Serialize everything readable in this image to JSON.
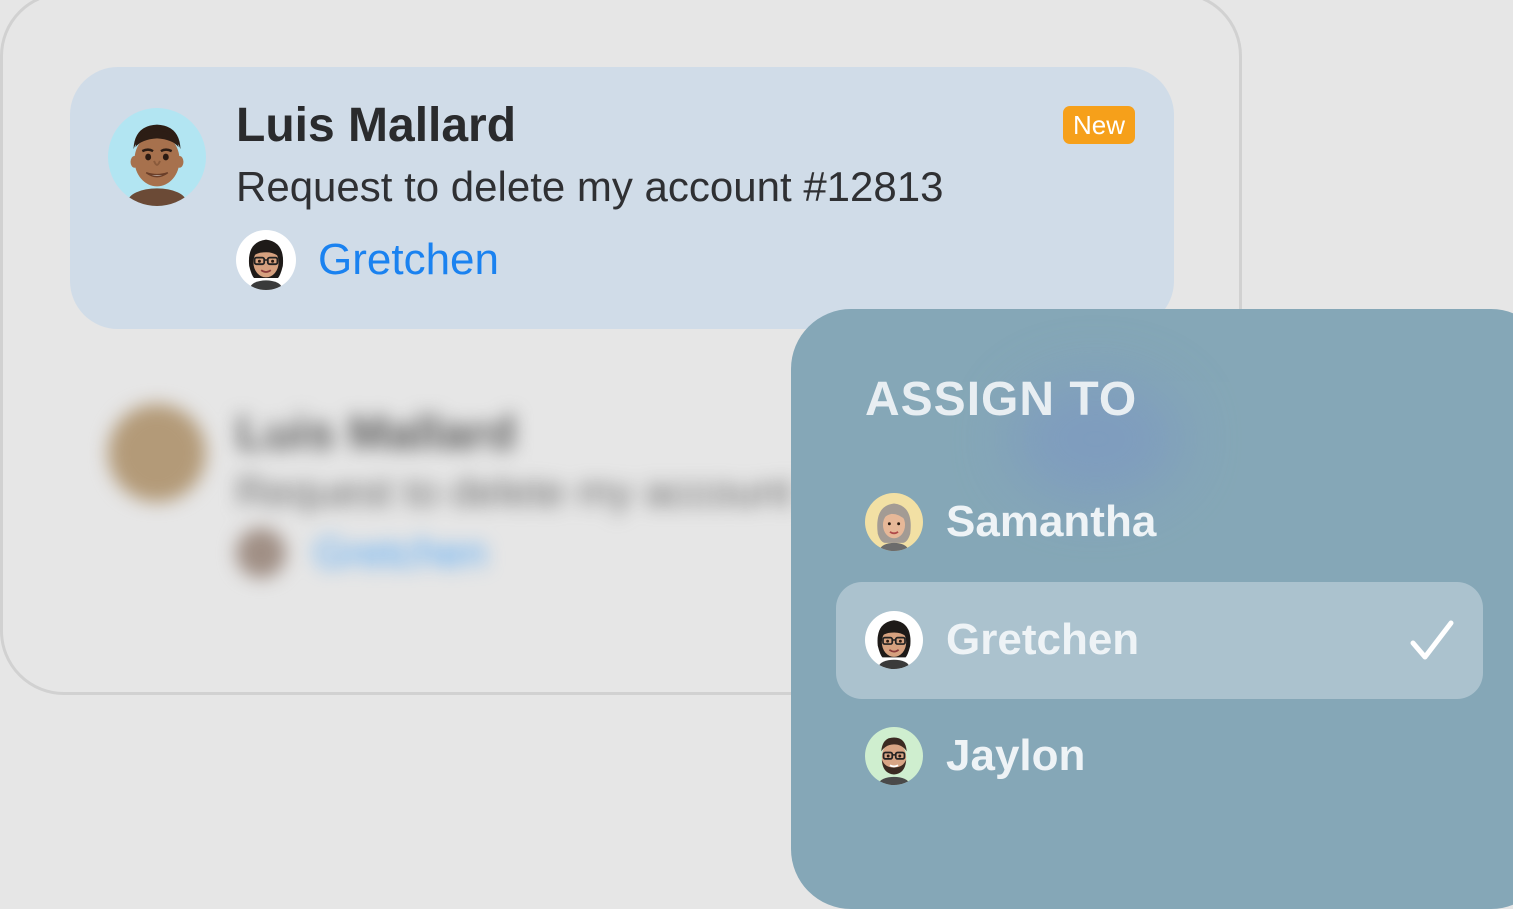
{
  "ticket": {
    "customer": "Luis Mallard",
    "subject": "Request to delete my account #12813",
    "assignee": "Gretchen",
    "badge": "New",
    "customer_avatar_icon": "man-memoji-icon",
    "assignee_avatar_icon": "woman-glasses-memoji-icon"
  },
  "ticket_blurred": {
    "customer": "Luis Mallard",
    "subject": "Request to delete my account",
    "assignee": "Gretchen"
  },
  "assign_menu": {
    "title": "ASSIGN TO",
    "options": [
      {
        "label": "Samantha",
        "avatar_icon": "woman-gray-hair-memoji-icon",
        "selected": false
      },
      {
        "label": "Gretchen",
        "avatar_icon": "woman-glasses-memoji-icon",
        "selected": true
      },
      {
        "label": "Jaylon",
        "avatar_icon": "man-beard-glasses-memoji-icon",
        "selected": false
      }
    ],
    "selected_indicator_icon": "checkmark-icon"
  },
  "colors": {
    "background": "#e6e6e6",
    "card": "#d0dce8",
    "badge": "#f6a01a",
    "link": "#1a82f0",
    "menu": "#85a7b7",
    "menu_selected": "#abc2ce"
  }
}
